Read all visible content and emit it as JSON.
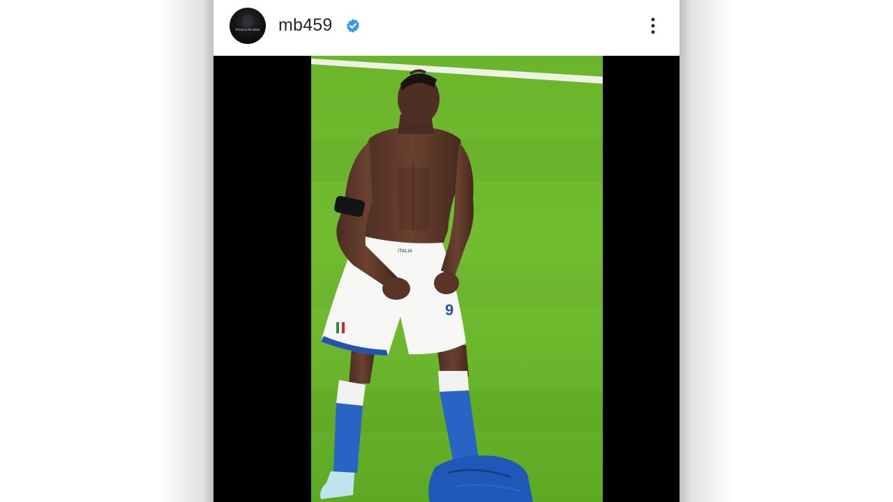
{
  "post": {
    "username": "mb459",
    "verified": true,
    "avatar": {
      "caption": "Proud to be black",
      "icon": "profile-avatar"
    },
    "more_icon": "more-vertical-icon",
    "verified_icon": "verified-badge-icon",
    "photo": {
      "shorts_text": "ITALIA",
      "number": "9"
    }
  },
  "colors": {
    "verified_blue": "#3897f0",
    "pitch_green": "#6fba2c",
    "jersey_blue": "#1f58b8",
    "text_dark": "#262626"
  }
}
